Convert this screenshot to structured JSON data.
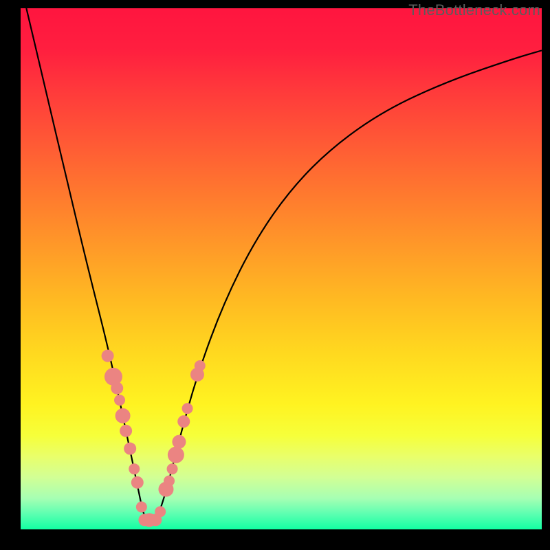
{
  "watermark": "TheBottleneck.com",
  "chart_data": {
    "type": "line",
    "title": "",
    "xlabel": "",
    "ylabel": "",
    "xlim": [
      0,
      1
    ],
    "ylim": [
      0,
      1
    ],
    "series": [
      {
        "name": "curve",
        "x": [
          0.011,
          0.05,
          0.09,
          0.13,
          0.17,
          0.2,
          0.225,
          0.2385,
          0.26,
          0.28,
          0.305,
          0.34,
          0.39,
          0.45,
          0.52,
          0.6,
          0.7,
          0.82,
          0.945,
          1.0
        ],
        "values": [
          1.0,
          0.835,
          0.665,
          0.498,
          0.34,
          0.2,
          0.08,
          0.015,
          0.015,
          0.075,
          0.175,
          0.3,
          0.435,
          0.555,
          0.655,
          0.735,
          0.805,
          0.86,
          0.903,
          0.919
        ]
      }
    ],
    "markers": [
      {
        "x": 0.167,
        "y": 0.333,
        "r": 9
      },
      {
        "x": 0.178,
        "y": 0.293,
        "r": 13
      },
      {
        "x": 0.185,
        "y": 0.271,
        "r": 9
      },
      {
        "x": 0.19,
        "y": 0.248,
        "r": 8
      },
      {
        "x": 0.196,
        "y": 0.218,
        "r": 11
      },
      {
        "x": 0.202,
        "y": 0.189,
        "r": 9
      },
      {
        "x": 0.21,
        "y": 0.155,
        "r": 9
      },
      {
        "x": 0.218,
        "y": 0.116,
        "r": 8
      },
      {
        "x": 0.224,
        "y": 0.09,
        "r": 9
      },
      {
        "x": 0.232,
        "y": 0.043,
        "r": 8
      },
      {
        "x": 0.238,
        "y": 0.018,
        "r": 9
      },
      {
        "x": 0.247,
        "y": 0.018,
        "r": 10
      },
      {
        "x": 0.259,
        "y": 0.018,
        "r": 9
      },
      {
        "x": 0.268,
        "y": 0.034,
        "r": 8
      },
      {
        "x": 0.279,
        "y": 0.077,
        "r": 11
      },
      {
        "x": 0.285,
        "y": 0.093,
        "r": 8
      },
      {
        "x": 0.291,
        "y": 0.116,
        "r": 8
      },
      {
        "x": 0.298,
        "y": 0.143,
        "r": 12
      },
      {
        "x": 0.304,
        "y": 0.168,
        "r": 10
      },
      {
        "x": 0.313,
        "y": 0.207,
        "r": 9
      },
      {
        "x": 0.32,
        "y": 0.232,
        "r": 8
      },
      {
        "x": 0.339,
        "y": 0.297,
        "r": 10
      },
      {
        "x": 0.344,
        "y": 0.314,
        "r": 8
      }
    ],
    "colors": {
      "curve": "#000000",
      "marker_fill": "#eb8482",
      "marker_stroke": "#eb8482"
    }
  }
}
